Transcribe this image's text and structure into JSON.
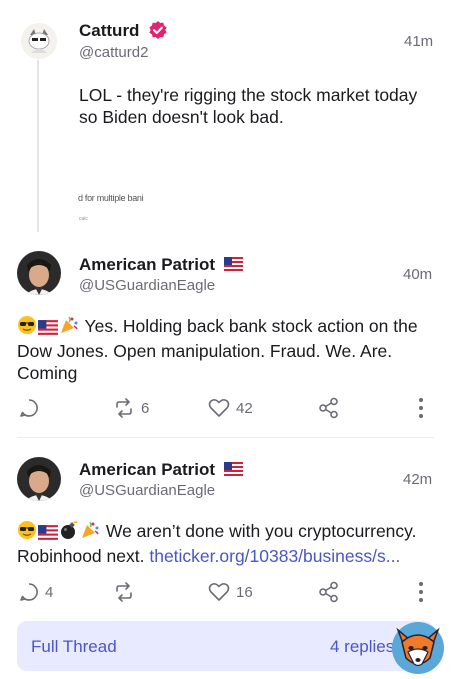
{
  "posts": [
    {
      "name": "Catturd",
      "verified": true,
      "handle": "@catturd2",
      "time": "41m",
      "text": "LOL - they're rigging the stock market today so Biden doesn't look bad.",
      "faded_text": "d for multiple bani",
      "faded_text_small": "cuic"
    },
    {
      "name": "American Patriot",
      "flag": "us-flag-icon",
      "handle": "@USGuardianEagle",
      "time": "40m",
      "text": "Yes. Holding back bank stock action on the Dow Jones. Open manipulation. Fraud. We. Are. Coming",
      "reposts": "6",
      "likes": "42"
    },
    {
      "name": "American Patriot",
      "flag": "us-flag-icon",
      "handle": "@USGuardianEagle",
      "time": "42m",
      "text": "We aren’t done with you cryptocurrency. Robinhood next.",
      "link": "theticker.org/10383/business/s...",
      "replies": "4",
      "likes": "16"
    }
  ],
  "thread_bar": {
    "label": "Full Thread",
    "replies": "4 replies"
  },
  "colors": {
    "accent": "#4a55c9",
    "verified": "#e0246e",
    "muted": "#6b6b76",
    "thread_bar_bg": "#e8eaff"
  }
}
